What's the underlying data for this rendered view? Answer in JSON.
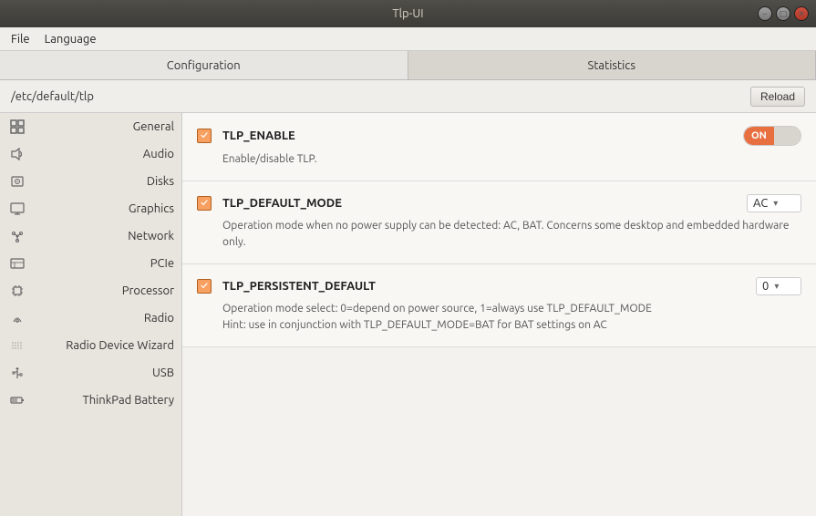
{
  "titlebar": {
    "title": "Tlp-UI",
    "controls": {
      "minimize": "–",
      "maximize": "□",
      "close": "✕"
    }
  },
  "menubar": {
    "items": [
      "File",
      "Language"
    ]
  },
  "tabs": [
    {
      "id": "configuration",
      "label": "Configuration",
      "active": true
    },
    {
      "id": "statistics",
      "label": "Statistics",
      "active": false
    }
  ],
  "pathbar": {
    "path": "/etc/default/tlp",
    "reload_label": "Reload"
  },
  "sidebar": {
    "items": [
      {
        "id": "general",
        "label": "General",
        "icon": "grid-icon"
      },
      {
        "id": "audio",
        "label": "Audio",
        "icon": "audio-icon"
      },
      {
        "id": "disks",
        "label": "Disks",
        "icon": "disk-icon"
      },
      {
        "id": "graphics",
        "label": "Graphics",
        "icon": "graphics-icon"
      },
      {
        "id": "network",
        "label": "Network",
        "icon": "network-icon"
      },
      {
        "id": "pcie",
        "label": "PCIe",
        "icon": "pcie-icon"
      },
      {
        "id": "processor",
        "label": "Processor",
        "icon": "processor-icon"
      },
      {
        "id": "radio",
        "label": "Radio",
        "icon": "radio-icon"
      },
      {
        "id": "radio-device-wizard",
        "label": "Radio Device Wizard",
        "icon": "radio-device-icon"
      },
      {
        "id": "usb",
        "label": "USB",
        "icon": "usb-icon"
      },
      {
        "id": "thinkpad-battery",
        "label": "ThinkPad Battery",
        "icon": "battery-icon"
      }
    ]
  },
  "settings": [
    {
      "id": "tlp-enable",
      "name": "TLP_ENABLE",
      "checked": true,
      "control_type": "toggle",
      "control_value": "ON",
      "description": "Enable/disable TLP."
    },
    {
      "id": "tlp-default-mode",
      "name": "TLP_DEFAULT_MODE",
      "checked": true,
      "control_type": "dropdown",
      "control_value": "AC",
      "description": "Operation mode when no power supply can be detected: AC, BAT.\nConcerns some desktop and embedded hardware only."
    },
    {
      "id": "tlp-persistent-default",
      "name": "TLP_PERSISTENT_DEFAULT",
      "checked": true,
      "control_type": "dropdown",
      "control_value": "0",
      "description": "Operation mode select: 0=depend on power source, 1=always use TLP_DEFAULT_MODE\nHint: use in conjunction with TLP_DEFAULT_MODE=BAT for BAT settings on AC"
    }
  ],
  "icons": {
    "grid": "⊞",
    "audio": "🔈",
    "disk": "💾",
    "graphics": "🖥",
    "network": "🌐",
    "pcie": "▤",
    "processor": "▫",
    "radio": "📶",
    "radio_device": "...",
    "usb": "⚡",
    "battery": "🔋",
    "chevron_down": "▾"
  }
}
